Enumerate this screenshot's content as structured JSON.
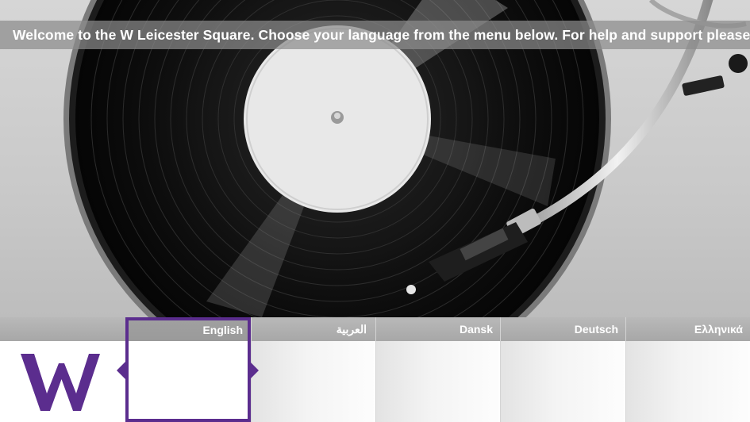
{
  "welcome": {
    "message": "Welcome to the W Leicester Square. Choose your language from the menu below. For help and support please"
  },
  "hero": {
    "image": "vinyl-record-turntable"
  },
  "brand": {
    "logo": "w-hotels-logo",
    "color": "#5b2d8e"
  },
  "languages": [
    {
      "label": "English",
      "selected": true
    },
    {
      "label": "العربية",
      "selected": false
    },
    {
      "label": "Dansk",
      "selected": false
    },
    {
      "label": "Deutsch",
      "selected": false
    },
    {
      "label": "Ελληνικά",
      "selected": false
    }
  ]
}
